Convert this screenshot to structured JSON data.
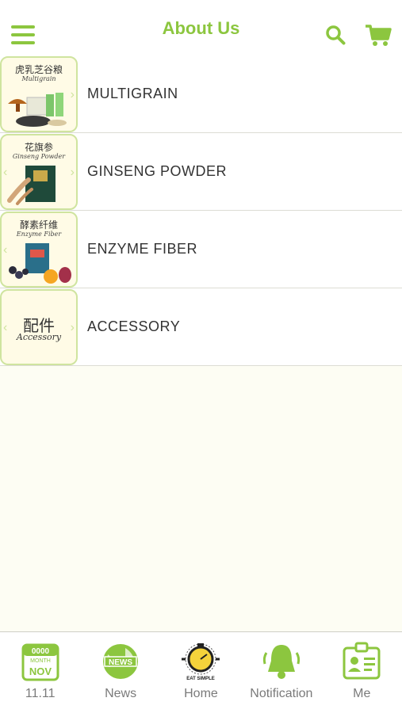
{
  "header": {
    "title": "About Us"
  },
  "colors": {
    "accent": "#8cc63f",
    "background": "#fdfdf3",
    "text": "#333333",
    "tab_text": "#7a7a7a"
  },
  "icons": {
    "menu": "hamburger-icon",
    "search": "search-icon",
    "cart": "cart-icon"
  },
  "items": [
    {
      "label": "MULTIGRAIN",
      "thumb_cn": "虎乳芝谷粮",
      "thumb_en": "Multigrain"
    },
    {
      "label": "GINSENG POWDER",
      "thumb_cn": "花旗参",
      "thumb_en": "Ginseng Powder"
    },
    {
      "label": "ENZYME FIBER",
      "thumb_cn": "酵素纤维",
      "thumb_en": "Enzyme Fiber"
    },
    {
      "label": "ACCESSORY",
      "thumb_cn": "配件",
      "thumb_en": "Accessory"
    }
  ],
  "calendar": {
    "top": "0000",
    "month": "MONTH",
    "month_name": "NOV"
  },
  "news_badge": "NEWS",
  "logo_text": "EAT SIMPLE",
  "tabs": [
    {
      "label": "11.11",
      "icon": "calendar-icon"
    },
    {
      "label": "News",
      "icon": "globe-news-icon"
    },
    {
      "label": "Home",
      "icon": "home-logo-icon"
    },
    {
      "label": "Notification",
      "icon": "bell-icon"
    },
    {
      "label": "Me",
      "icon": "id-card-icon"
    }
  ]
}
